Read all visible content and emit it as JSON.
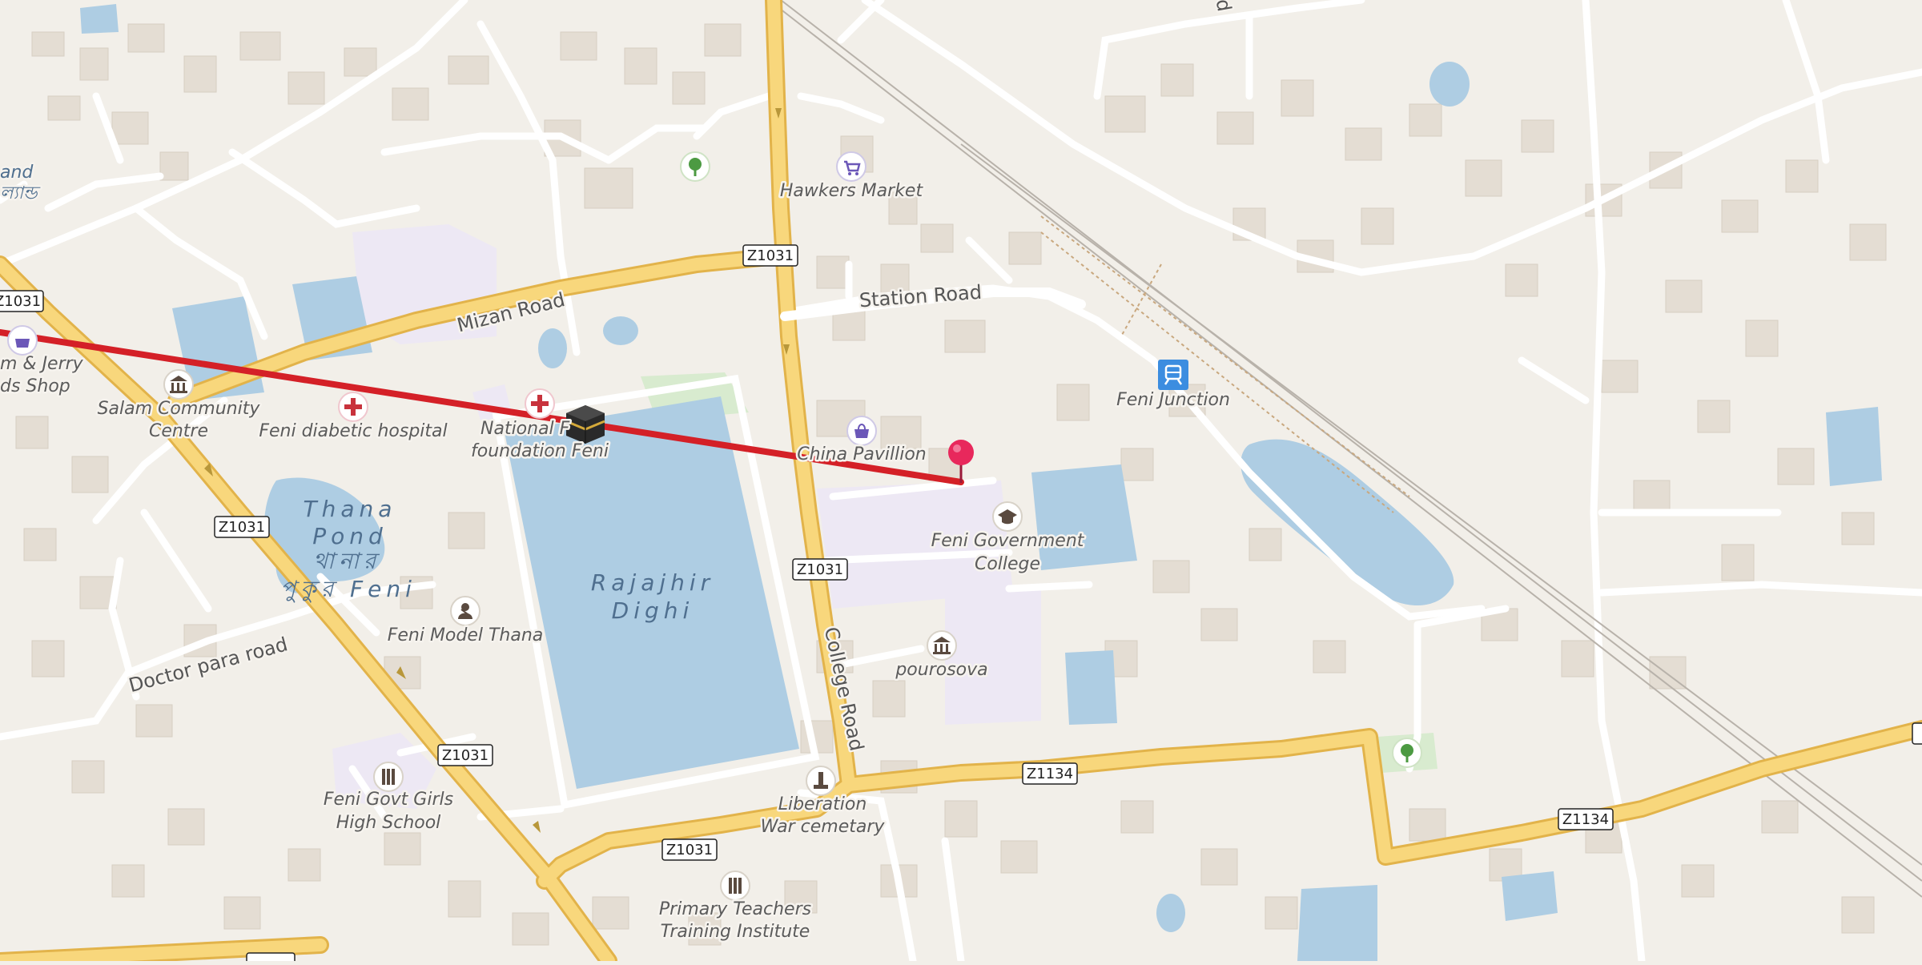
{
  "map": {
    "route_color": "#d42027",
    "marker_color": "#e8285c",
    "water_color": "#aecde3",
    "road_color": "#f6d57b",
    "land_color": "#f2efe9",
    "building_color": "#e4ddd3"
  },
  "road_shields": [
    {
      "id": "z1031-a",
      "text": "Z1031"
    },
    {
      "id": "z1031-b",
      "text": "Z1031"
    },
    {
      "id": "z1031-c",
      "text": "Z1031"
    },
    {
      "id": "z1031-d",
      "text": "Z1031"
    },
    {
      "id": "z1031-e",
      "text": "Z1031"
    },
    {
      "id": "z1031-f",
      "text": "Z1031"
    },
    {
      "id": "z1134-a",
      "text": "Z1134"
    },
    {
      "id": "z1134-b",
      "text": "Z1134"
    }
  ],
  "road_names": {
    "mizan": "Mizan Road",
    "station": "Station Road",
    "college": "College Road",
    "doctor_para": "Doctor para road"
  },
  "water_names": {
    "rajajhir_1": "Rajajhir",
    "rajajhir_2": "Dighi",
    "thana_1": "Thana",
    "thana_2": "Pond",
    "thana_3": "থানার",
    "thana_4": "পুকুর Feni"
  },
  "pois": {
    "hawkers_market": "Hawkers Market",
    "feni_junction": "Feni Junction",
    "china_pavillion": "China Pavillion",
    "feni_gov_college_1": "Feni Government",
    "feni_gov_college_2": "College",
    "pourosova": "pourosova",
    "liberation_1": "Liberation",
    "liberation_2": "War cemetary",
    "primary_teachers_1": "Primary Teachers",
    "primary_teachers_2": "Training Institute",
    "feni_model_thana": "Feni Model Thana",
    "feni_govt_girls_1": "Feni Govt Girls",
    "feni_govt_girls_2": "High School",
    "feni_diabetic": "Feni diabetic hospital",
    "national_1": "National F",
    "national_2": "foundation Feni",
    "salam_1": "Salam Community",
    "salam_2": "Centre",
    "tom_jerry_1": "m & Jerry",
    "tom_jerry_2": "ds Shop",
    "partial_and_1": "and",
    "partial_and_2": "ল্যান্ড",
    "partial_d": "d"
  },
  "icons": {
    "shop": "shopping-cart-icon",
    "bag": "shopping-bag-icon",
    "train": "train-station-icon",
    "college": "graduation-cap-icon",
    "townhall": "town-hall-icon",
    "hospital": "hospital-cross-icon",
    "mosque": "kaaba-icon",
    "park": "tree-icon",
    "police": "police-icon",
    "school": "school-icon",
    "memorial": "memorial-icon",
    "pin": "location-pin-icon"
  }
}
